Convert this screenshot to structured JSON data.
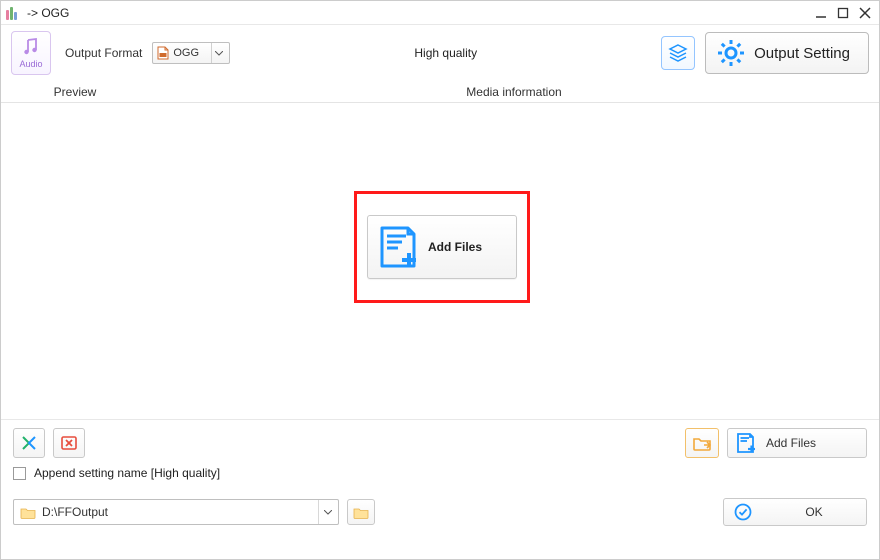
{
  "window": {
    "title": "-> OGG"
  },
  "toolbar": {
    "audio_label": "Audio",
    "output_format_label": "Output Format",
    "output_format_value": "OGG",
    "quality_label": "High quality",
    "output_setting_label": "Output Setting"
  },
  "headers": {
    "preview": "Preview",
    "media_info": "Media information"
  },
  "center": {
    "add_files_label": "Add Files"
  },
  "bottom": {
    "append_setting_label": "Append setting name [High quality]",
    "output_path": "D:\\FFOutput",
    "add_files_label": "Add Files",
    "ok_label": "OK"
  },
  "icons": {
    "audio": "music-note-icon",
    "format_file": "file-icon",
    "layers": "layers-icon",
    "gear": "gear-icon",
    "add_doc": "add-document-icon",
    "merge": "merge-icon",
    "delete": "delete-icon",
    "folder_arrow": "folder-export-icon",
    "folder": "folder-icon",
    "check_circle": "check-circle-icon"
  },
  "colors": {
    "accent_blue": "#1e95ff",
    "highlight_red": "#ff1a1a",
    "amber": "#f2a93b",
    "purple": "#9a6bd6",
    "red_x": "#e74c3c",
    "green": "#21b26b"
  }
}
